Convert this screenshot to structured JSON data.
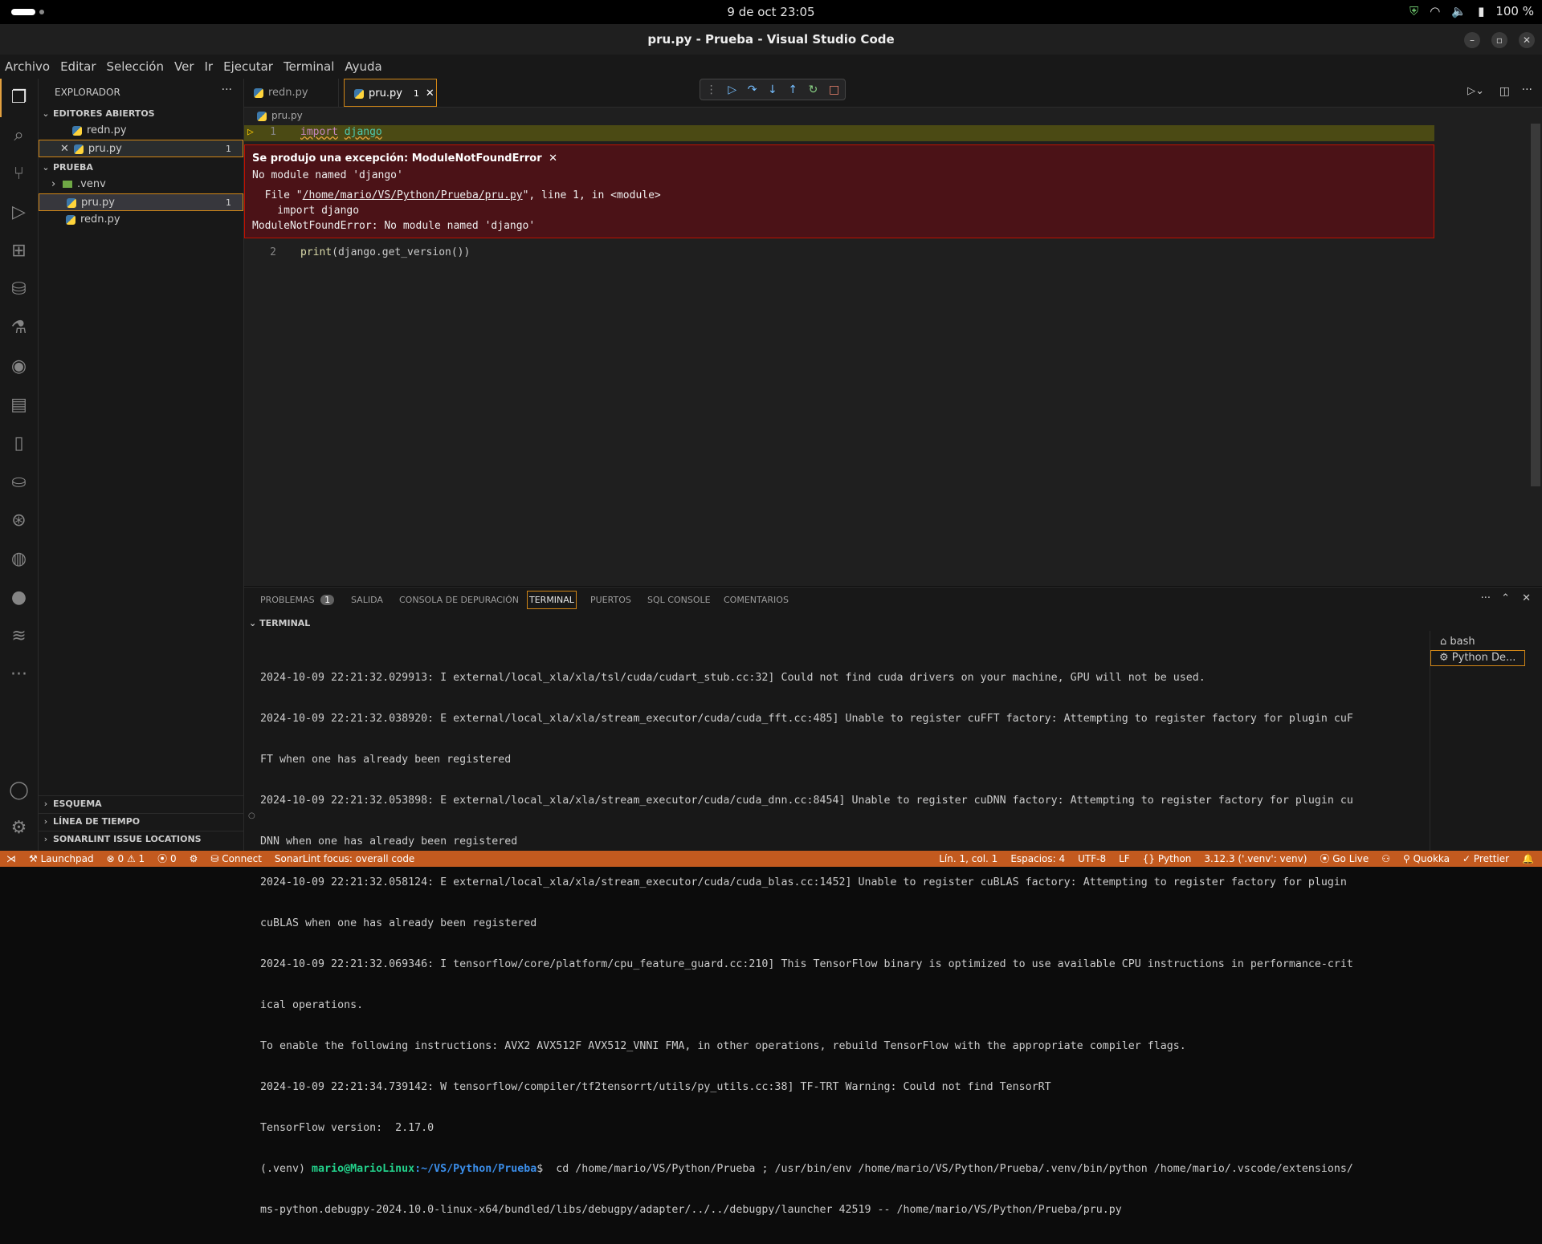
{
  "system": {
    "clock": "9 de oct  23:05",
    "battery": "100 %"
  },
  "window": {
    "title": "pru.py - Prueba - Visual Studio Code"
  },
  "menu": [
    "Archivo",
    "Editar",
    "Selección",
    "Ver",
    "Ir",
    "Ejecutar",
    "Terminal",
    "Ayuda"
  ],
  "sidebar": {
    "title": "EXPLORADOR",
    "open_editors_title": "EDITORES ABIERTOS",
    "open_editors": [
      {
        "name": "redn.py",
        "badge": ""
      },
      {
        "name": "pru.py",
        "badge": "1"
      }
    ],
    "project_title": "PRUEBA",
    "project_items": [
      {
        "name": ".venv",
        "type": "folder",
        "badge": ""
      },
      {
        "name": "pru.py",
        "type": "file",
        "badge": "1"
      },
      {
        "name": "redn.py",
        "type": "file",
        "badge": ""
      }
    ],
    "bottom_sections": [
      "ESQUEMA",
      "LÍNEA DE TIEMPO",
      "SONARLINT ISSUE LOCATIONS"
    ]
  },
  "tabs": [
    {
      "name": "redn.py",
      "badge": ""
    },
    {
      "name": "pru.py",
      "badge": "1"
    }
  ],
  "breadcrumb": "pru.py",
  "code": {
    "line1_num": "1",
    "line1_kw": "import",
    "line1_mod": "django",
    "line2_num": "2",
    "line2_fn": "print",
    "line2_rest": "(django.get_version())"
  },
  "exception": {
    "title": "Se produjo una excepción: ModuleNotFoundError",
    "message": "No module named 'django'",
    "file_prefix": "  File \"",
    "file_path": "/home/mario/VS/Python/Prueba/pru.py",
    "file_suffix": "\", line 1, in <module>",
    "code_line": "    import django",
    "error_line": "ModuleNotFoundError: No module named 'django'"
  },
  "panel": {
    "tabs": [
      "PROBLEMAS",
      "SALIDA",
      "CONSOLA DE DEPURACIÓN",
      "TERMINAL",
      "PUERTOS",
      "SQL CONSOLE",
      "COMENTARIOS"
    ],
    "problems_badge": "1",
    "section_title": "TERMINAL",
    "terminal_lines": [
      "2024-10-09 22:21:32.029913: I external/local_xla/xla/tsl/cuda/cudart_stub.cc:32] Could not find cuda drivers on your machine, GPU will not be used.",
      "2024-10-09 22:21:32.038920: E external/local_xla/xla/stream_executor/cuda/cuda_fft.cc:485] Unable to register cuFFT factory: Attempting to register factory for plugin cuF",
      "FT when one has already been registered",
      "2024-10-09 22:21:32.053898: E external/local_xla/xla/stream_executor/cuda/cuda_dnn.cc:8454] Unable to register cuDNN factory: Attempting to register factory for plugin cu",
      "DNN when one has already been registered",
      "2024-10-09 22:21:32.058124: E external/local_xla/xla/stream_executor/cuda/cuda_blas.cc:1452] Unable to register cuBLAS factory: Attempting to register factory for plugin",
      "cuBLAS when one has already been registered",
      "2024-10-09 22:21:32.069346: I tensorflow/core/platform/cpu_feature_guard.cc:210] This TensorFlow binary is optimized to use available CPU instructions in performance-crit",
      "ical operations.",
      "To enable the following instructions: AVX2 AVX512F AVX512_VNNI FMA, in other operations, rebuild TensorFlow with the appropriate compiler flags.",
      "2024-10-09 22:21:34.739142: W tensorflow/compiler/tf2tensorrt/utils/py_utils.cc:38] TF-TRT Warning: Could not find TensorRT",
      "TensorFlow version:  2.17.0"
    ],
    "prompt_env": "(.venv) ",
    "prompt_user": "mario@MarioLinux",
    "prompt_path": ":~/VS/Python/Prueba",
    "prompt_cmd": "$  cd /home/mario/VS/Python/Prueba ; /usr/bin/env /home/mario/VS/Python/Prueba/.venv/bin/python /home/mario/.vscode/extensions/",
    "prompt_cont": "ms-python.debugpy-2024.10.0-linux-x64/bundled/libs/debugpy/adapter/../../debugpy/launcher 42519 -- /home/mario/VS/Python/Prueba/pru.py",
    "terminals": [
      "bash",
      "Python De..."
    ]
  },
  "status": {
    "launchpad": "Launchpad",
    "errors": "0",
    "warnings": "1",
    "ports": "0",
    "connect": "Connect",
    "sonar": "SonarLint focus: overall code",
    "position": "Lín. 1, col. 1",
    "spaces": "Espacios: 4",
    "encoding": "UTF-8",
    "eol": "LF",
    "language": "Python",
    "interpreter": "3.12.3 ('.venv': venv)",
    "golive": "Go Live",
    "quokka": "Quokka",
    "prettier": "Prettier"
  },
  "colors": {
    "statusbar": "#c35a1f",
    "error_bg": "#4b1217",
    "error_border": "#be1100",
    "accent": "#e2a03f"
  }
}
